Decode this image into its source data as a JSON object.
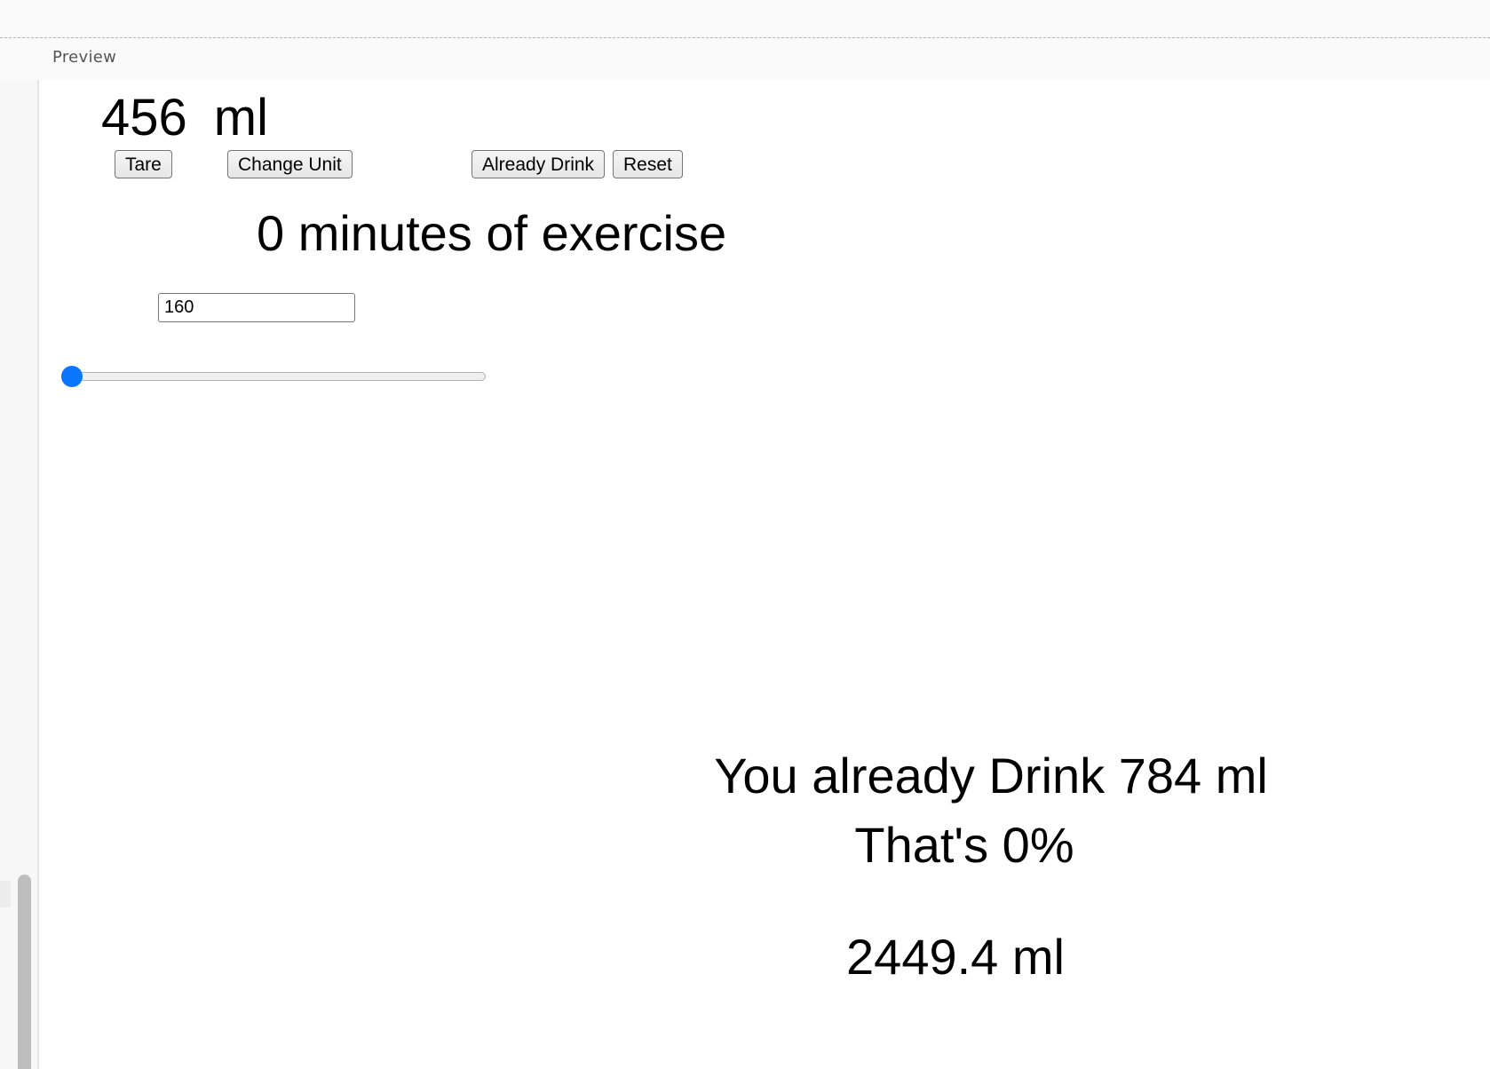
{
  "header": {
    "preview_label": "Preview"
  },
  "scale": {
    "weight_value": "456",
    "weight_unit": "ml"
  },
  "buttons": {
    "tare": "Tare",
    "change_unit": "Change Unit",
    "already_drink": "Already Drink",
    "reset": "Reset"
  },
  "exercise": {
    "text": "0 minutes of exercise",
    "slider_value": 0
  },
  "weight_input": {
    "value": "160"
  },
  "result": {
    "drank_text": "You already Drink 784 ml",
    "percent_text": "That's 0%",
    "goal_text": "2449.4 ml"
  },
  "colors": {
    "slider_accent": "#0a75ff"
  }
}
